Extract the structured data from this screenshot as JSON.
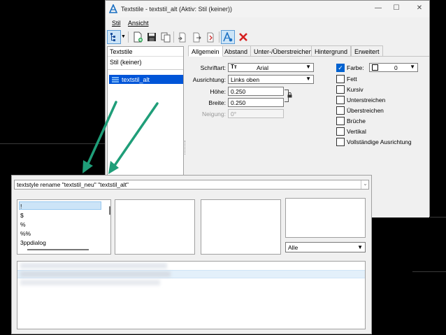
{
  "window": {
    "title": "Textstile - textstil_alt (Aktiv: Stil (keiner))",
    "minimize": "—",
    "maximize": "☐",
    "close": "✕"
  },
  "menu": [
    "Stil",
    "Ansicht"
  ],
  "left_panel": {
    "header": "Textstile",
    "items": [
      "Stil (keiner)"
    ],
    "selected": "textstil_alt"
  },
  "tabs": [
    "Allgemein",
    "Abstand",
    "Unter-/Überstreichen",
    "Hintergrund",
    "Erweitert"
  ],
  "general": {
    "font_label": "Schriftart:",
    "font_value": "Arial",
    "align_label": "Ausrichtung:",
    "align_value": "Links oben",
    "height_label": "Höhe:",
    "height_value": "0.250",
    "width_label": "Breite:",
    "width_value": "0.250",
    "slant_label": "Neigung:",
    "slant_value": "0°"
  },
  "options": {
    "color_label": "Farbe:",
    "color_value": "0",
    "checkboxes": [
      "Fett",
      "Kursiv",
      "Unterstreichen",
      "Überstreichen",
      "Brüche",
      "Vertikal",
      "Vollständige Ausrichtung"
    ]
  },
  "command": {
    "input_value": "textstyle rename \"textstil_neu\" \"textstil_alt\"",
    "list_items": [
      "!",
      "$",
      "%",
      "%%",
      "3ppdialog"
    ],
    "filter_value": "Alle"
  },
  "colors": {
    "selection": "#0055d8",
    "arrow": "#1f9e79",
    "delete": "#d62020"
  }
}
